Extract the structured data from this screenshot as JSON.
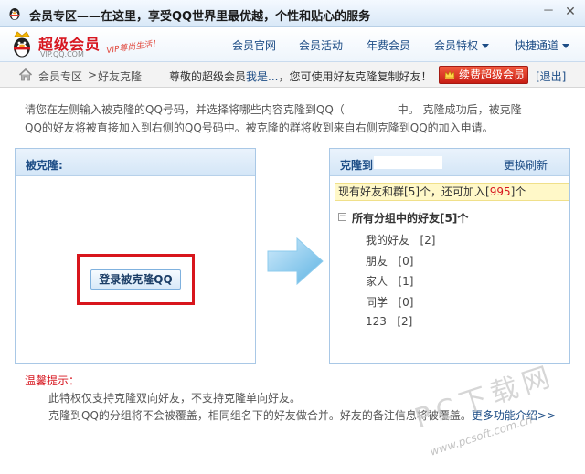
{
  "window": {
    "title": "会员专区——在这里，享受QQ世界里最优越，个性和贴心的服务",
    "minimize_label": "－",
    "close_label": "✕"
  },
  "nav": {
    "logo_title": "超级会员",
    "logo_sub": "VIP.QQ.COM",
    "logo_slogan": "VIP尊尚生活！",
    "links": [
      {
        "label": "会员官网"
      },
      {
        "label": "会员活动"
      },
      {
        "label": "年费会员"
      },
      {
        "label": "会员特权"
      },
      {
        "label": "快捷通道"
      }
    ]
  },
  "breadcrumb": {
    "home": "会员专区",
    "separator": ">",
    "current": "好友克隆",
    "greeting_prefix": "尊敬的超级会员",
    "greeting_user": "我是...",
    "greeting_suffix": "，您可使用好友克隆复制好友！",
    "renew_button": "续费超级会员",
    "logout": "[退出]"
  },
  "description": {
    "line1_a": "请您在左侧输入被克隆的QQ号码，并选择将哪些内容克隆到QQ（",
    "line1_b": "中。 克隆成功后，被克隆",
    "line2": "QQ的好友将被直接加入到右侧的QQ号码中。被克隆的群将收到来自右侧克隆到QQ的加入申请。"
  },
  "left_panel": {
    "title": "被克隆:",
    "login_button": "登录被克隆QQ"
  },
  "right_panel": {
    "title": "克隆到",
    "refresh_link": "更换刷新",
    "info_prefix": "现有好友和群[",
    "info_count": "5",
    "info_mid": "]个，还可加入[",
    "info_remaining": "995",
    "info_suffix": "]个",
    "group_toggle": "−",
    "group_title": "所有分组中的好友[5]个",
    "groups": [
      {
        "name": "我的好友",
        "count": "[2]"
      },
      {
        "name": "朋友",
        "count": "[0]"
      },
      {
        "name": "家人",
        "count": "[1]"
      },
      {
        "name": "同学",
        "count": "[0]"
      },
      {
        "name": "123",
        "count": "[2]"
      }
    ]
  },
  "tips": {
    "title": "温馨提示：",
    "line1": "此特权仅支持克隆双向好友，不支持克隆单向好友。",
    "line2": "克隆到QQ的分组将不会被覆盖，相同组名下的好友做合并。好友的备注信息将被覆盖。",
    "more": "更多功能介绍>>"
  },
  "watermark": {
    "text": "PC下载网",
    "url": "www.pcsoft.com.cn"
  },
  "colors": {
    "brand_red": "#d7161f",
    "link_blue": "#1d4d86",
    "panel_border": "#a9c8e6",
    "arrow_blue": "#7cc3ea",
    "highlight_yellow": "#fff8c8"
  }
}
